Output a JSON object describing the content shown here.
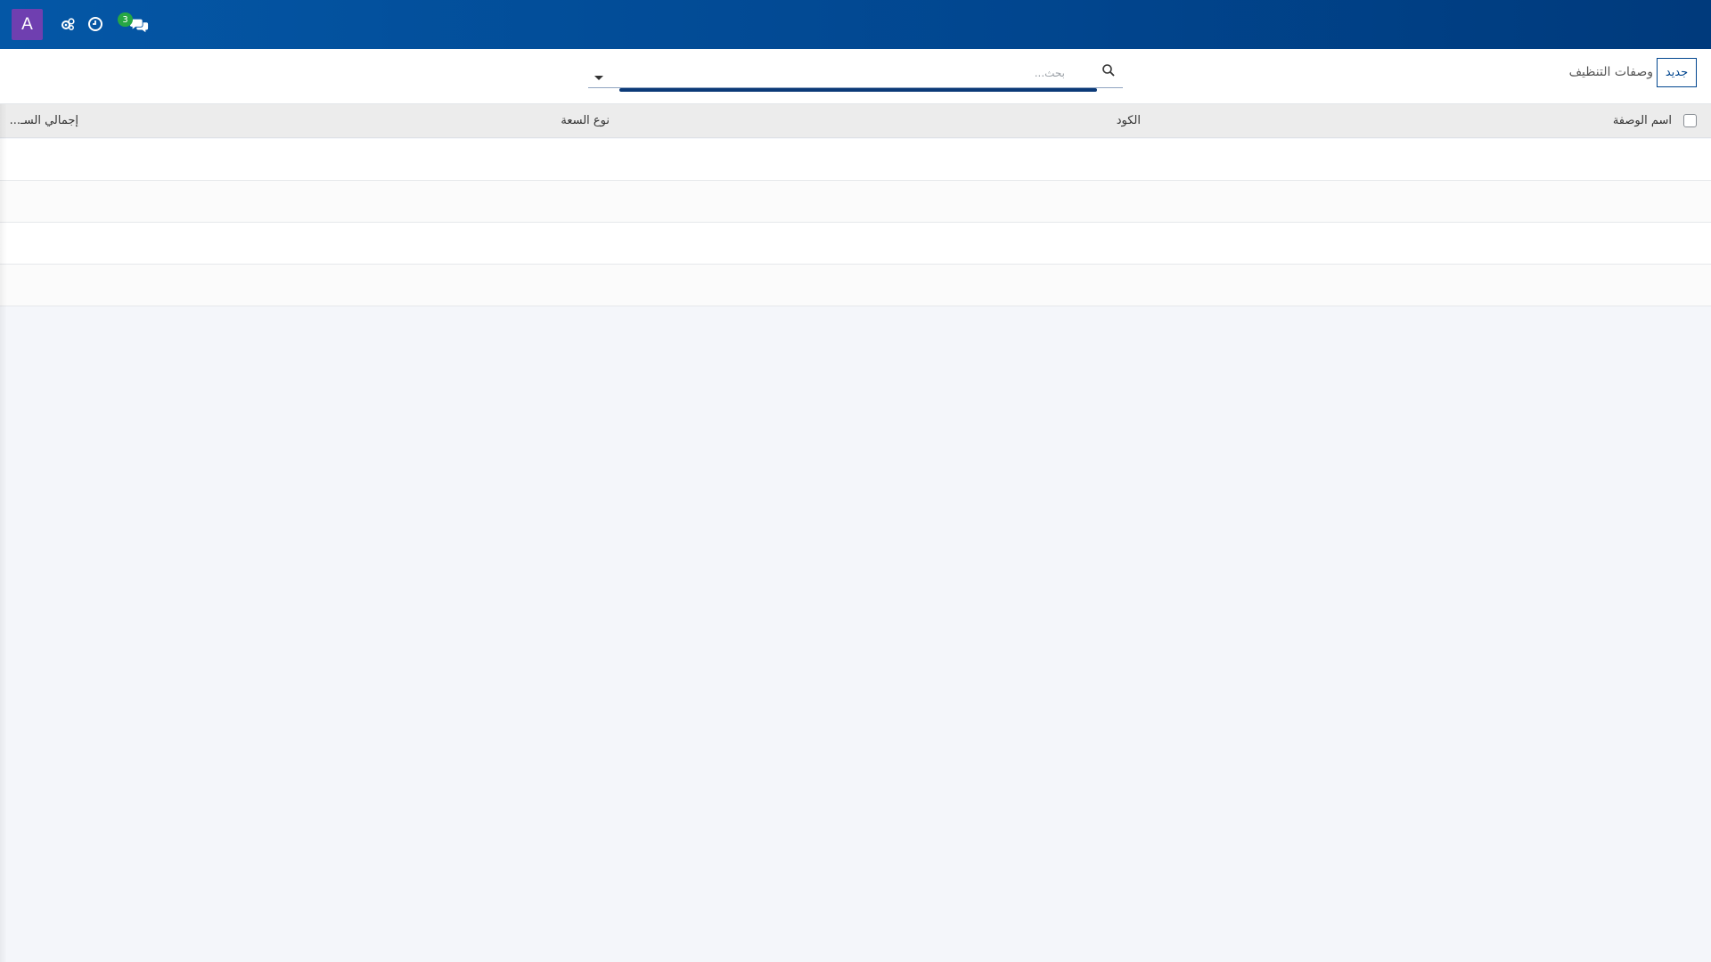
{
  "topbar": {
    "avatar_letter": "A",
    "messages_count": "3",
    "colors": {
      "bar": "#01468f",
      "avatar": "#6f3fb0",
      "badge": "#27a744"
    },
    "icons": [
      "settings-icon",
      "clock-icon",
      "chat-icon"
    ]
  },
  "control": {
    "new_button": "جديد",
    "page_title": "وصفات التنظيف",
    "search_placeholder": "بحث..."
  },
  "table": {
    "columns": [
      "اسم الوصفة",
      "الكود",
      "نوع السعة",
      "إجمالي السـ..."
    ],
    "rows": [
      {
        "cells": [
          "",
          "",
          "",
          ""
        ]
      },
      {
        "cells": [
          "",
          "",
          "",
          ""
        ]
      },
      {
        "cells": [
          "",
          "",
          "",
          ""
        ]
      },
      {
        "cells": [
          "",
          "",
          "",
          ""
        ]
      }
    ]
  }
}
